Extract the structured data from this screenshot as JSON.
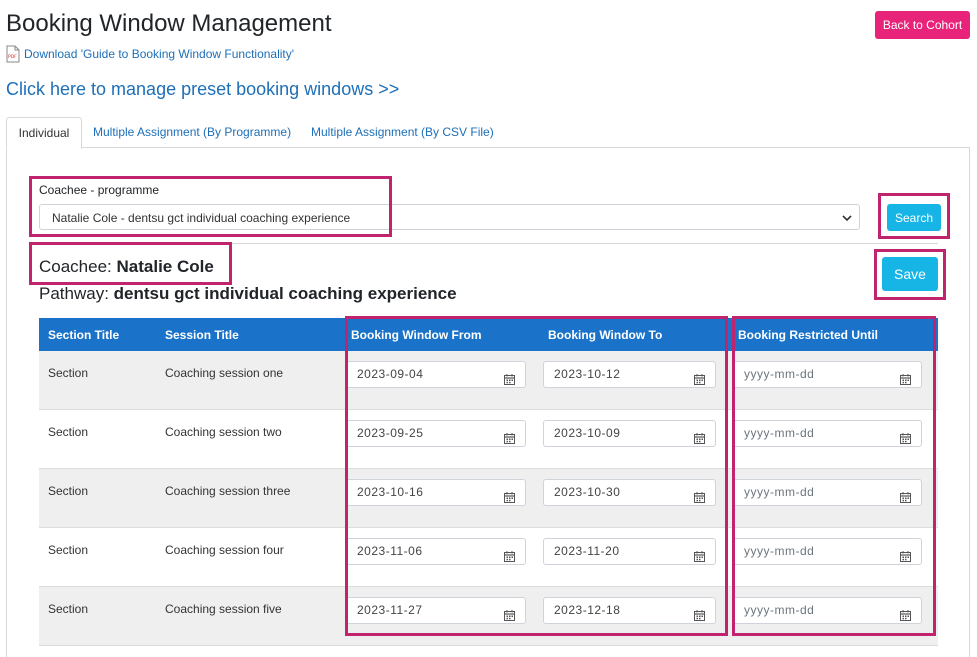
{
  "header": {
    "title": "Booking Window Management",
    "back_label": "Back to Cohort",
    "pdf_link": "Download 'Guide to Booking Window Functionality'",
    "preset_link": "Click here to manage preset booking windows >>"
  },
  "tabs": [
    {
      "label": "Individual"
    },
    {
      "label": "Multiple Assignment (By Programme)"
    },
    {
      "label": "Multiple Assignment (By CSV File)"
    }
  ],
  "form": {
    "select_label": "Coachee - programme",
    "select_value": "Natalie Cole - dentsu gct individual coaching experience",
    "search_label": "Search"
  },
  "info": {
    "coachee_label": "Coachee:",
    "coachee_name": "Natalie Cole",
    "pathway_label": "Pathway:",
    "pathway_name": "dentsu gct individual coaching experience",
    "save_label": "Save"
  },
  "table": {
    "headers": [
      "Section Title",
      "Session Title",
      "Booking Window From",
      "Booking Window To",
      "Booking Restricted Until"
    ],
    "date_placeholder": "yyyy-mm-dd",
    "rows": [
      {
        "section": "Section",
        "session": "Coaching session one",
        "from": "2023-09-04",
        "to": "2023-10-12",
        "until": ""
      },
      {
        "section": "Section",
        "session": "Coaching session two",
        "from": "2023-09-25",
        "to": "2023-10-09",
        "until": ""
      },
      {
        "section": "Section",
        "session": "Coaching session three",
        "from": "2023-10-16",
        "to": "2023-10-30",
        "until": ""
      },
      {
        "section": "Section",
        "session": "Coaching session four",
        "from": "2023-11-06",
        "to": "2023-11-20",
        "until": ""
      },
      {
        "section": "Section",
        "session": "Coaching session five",
        "from": "2023-11-27",
        "to": "2023-12-18",
        "until": ""
      }
    ]
  },
  "colors": {
    "accent_pink": "#e8237a",
    "highlight": "#c0246e",
    "button_blue": "#17b5e6",
    "header_blue": "#1a73c8",
    "link_blue": "#1d6fb8"
  }
}
